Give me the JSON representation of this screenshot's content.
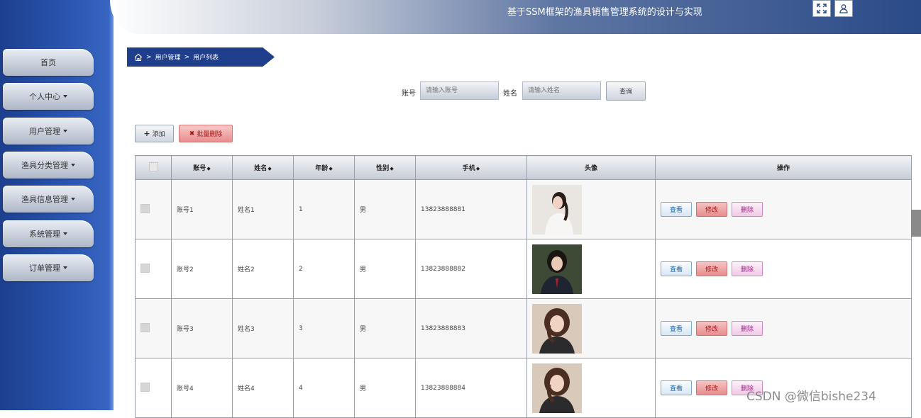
{
  "header": {
    "title": "基于SSM框架的渔具销售管理系统的设计与实现"
  },
  "sidebar": {
    "items": [
      {
        "label": "首页"
      },
      {
        "label": "个人中心"
      },
      {
        "label": "用户管理"
      },
      {
        "label": "渔具分类管理"
      },
      {
        "label": "渔具信息管理"
      },
      {
        "label": "系统管理"
      },
      {
        "label": "订单管理"
      }
    ]
  },
  "breadcrumb": {
    "sep": ">",
    "level1": "用户管理",
    "level2": "用户列表"
  },
  "search": {
    "account_label": "账号",
    "account_placeholder": "请输入账号",
    "name_label": "姓名",
    "name_placeholder": "请输入姓名",
    "query_button": "查询"
  },
  "toolbar": {
    "add": "添加",
    "batch_delete": "批量删除"
  },
  "table": {
    "headers": {
      "account": "账号",
      "name": "姓名",
      "age": "年龄",
      "gender": "性别",
      "phone": "手机",
      "avatar": "头像",
      "actions": "操作"
    },
    "sort_glyph": "◆",
    "rows": [
      {
        "account": "账号1",
        "name": "姓名1",
        "age": "1",
        "gender": "男",
        "phone": "13823888881"
      },
      {
        "account": "账号2",
        "name": "姓名2",
        "age": "2",
        "gender": "男",
        "phone": "13823888882"
      },
      {
        "account": "账号3",
        "name": "姓名3",
        "age": "3",
        "gender": "男",
        "phone": "13823888883"
      },
      {
        "account": "账号4",
        "name": "姓名4",
        "age": "4",
        "gender": "男",
        "phone": "13823888884"
      }
    ],
    "actions": {
      "view": "查看",
      "edit": "修改",
      "delete": "删除"
    }
  },
  "watermark": "CSDN @微信bishe234",
  "colors": {
    "primary": "#1f3f8c",
    "sidebar": "#2a55b0"
  }
}
